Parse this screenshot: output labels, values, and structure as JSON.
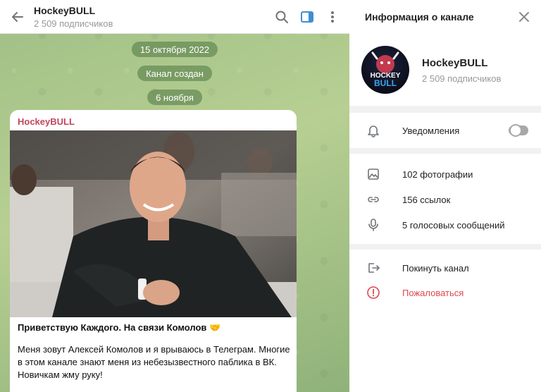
{
  "chat": {
    "title": "HockeyBULL",
    "subscribers": "2 509 подписчиков",
    "date_pills": [
      "15 октября 2022",
      "Канал создан",
      "6 ноября"
    ],
    "post": {
      "author": "HockeyBULL",
      "headline": "Приветствую Каждого. На связи Комолов 🤝",
      "body": "Меня зовут Алексей Комолов и я врываюсь в Телеграм. Многие в этом канале знают меня из небезызвестного паблика в ВК. Новичкам жму руку!"
    }
  },
  "info_panel": {
    "title": "Информация о канале",
    "channel_name": "HockeyBULL",
    "channel_subscribers": "2 509 подписчиков",
    "avatar_text": [
      "HOCKEY",
      "BULL"
    ],
    "notifications_label": "Уведомления",
    "notifications_enabled": false,
    "media": {
      "photos": "102 фотографии",
      "links": "156 ссылок",
      "voice": "5 голосовых сообщений"
    },
    "actions": {
      "leave": "Покинуть канал",
      "report": "Пожаловаться"
    }
  },
  "colors": {
    "accent": "#3f8fd2",
    "author": "#c0465c",
    "danger": "#e0474f",
    "pill_bg": "#5c8a4e"
  },
  "icons": [
    "back-arrow-icon",
    "search-icon",
    "sidebar-toggle-icon",
    "more-vertical-icon",
    "close-icon",
    "bell-icon",
    "photo-icon",
    "link-icon",
    "microphone-icon",
    "logout-icon",
    "report-icon"
  ]
}
